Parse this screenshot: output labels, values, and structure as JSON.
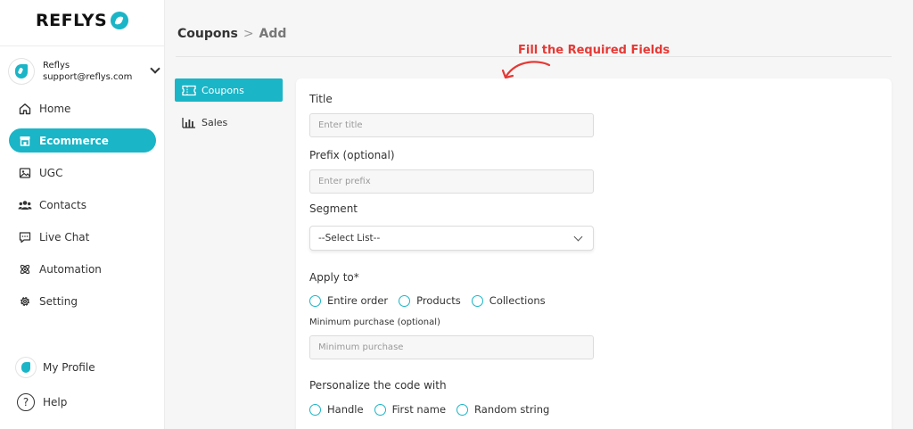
{
  "brand": {
    "name": "REFLYS",
    "accent": "#1ab5c7"
  },
  "account": {
    "name": "Reflys",
    "email": "support@reflys.com"
  },
  "sidebar": {
    "items": [
      {
        "label": "Home",
        "icon": "home-icon"
      },
      {
        "label": "Ecommerce",
        "icon": "store-icon",
        "active": true
      },
      {
        "label": "UGC",
        "icon": "image-icon"
      },
      {
        "label": "Contacts",
        "icon": "users-icon"
      },
      {
        "label": "Live Chat",
        "icon": "chat-icon"
      },
      {
        "label": "Automation",
        "icon": "atom-icon"
      },
      {
        "label": "Setting",
        "icon": "gear-icon"
      }
    ],
    "bottom": [
      {
        "label": "My Profile",
        "icon": "profile-avatar-icon"
      },
      {
        "label": "Help",
        "icon": "help-icon"
      }
    ]
  },
  "breadcrumb": {
    "current": "Coupons",
    "separator": ">",
    "page": "Add"
  },
  "annotation": {
    "text": "Fill the Required Fields",
    "color": "#e53935"
  },
  "subnav": {
    "items": [
      {
        "label": "Coupons",
        "icon": "ticket-icon",
        "active": true
      },
      {
        "label": "Sales",
        "icon": "bar-chart-icon"
      }
    ]
  },
  "form": {
    "title": {
      "label": "Title",
      "placeholder": "Enter title",
      "value": ""
    },
    "prefix": {
      "label": "Prefix (optional)",
      "placeholder": "Enter prefix",
      "value": ""
    },
    "segment": {
      "label": "Segment",
      "selected": "--Select List--"
    },
    "apply_to": {
      "label": "Apply to*",
      "options": [
        "Entire order",
        "Products",
        "Collections"
      ]
    },
    "min_purchase": {
      "label": "Minimum purchase (optional)",
      "placeholder": "Minimum purchase",
      "value": ""
    },
    "personalize": {
      "label": "Personalize the code with",
      "options": [
        "Handle",
        "First name",
        "Random string"
      ]
    }
  }
}
